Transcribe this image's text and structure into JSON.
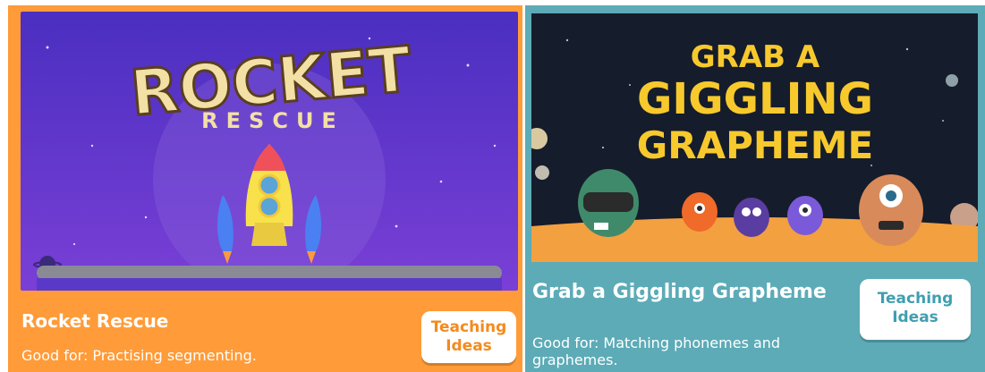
{
  "cards": [
    {
      "title": "Rocket Rescue",
      "description": "Good for: Practising segmenting.",
      "button": {
        "line1": "Teaching",
        "line2": "Ideas"
      },
      "thumbnail": {
        "title_line1": "ROCKET",
        "title_line2": "RESCUE"
      },
      "colors": {
        "card": "#ff9b38",
        "button_text": "#f48a1f",
        "sky": "#5a39c9"
      }
    },
    {
      "title": "Grab a Giggling Grapheme",
      "description": "Good for: Matching phonemes and graphemes.",
      "button": {
        "line1": "Teaching",
        "line2": "Ideas"
      },
      "thumbnail": {
        "title_line1": "GRAB A",
        "title_line2": "GIGGLING",
        "title_line3": "GRAPHEME"
      },
      "colors": {
        "card": "#5cabb7",
        "button_text": "#3f9fb0",
        "sky": "#151c2b"
      }
    }
  ]
}
